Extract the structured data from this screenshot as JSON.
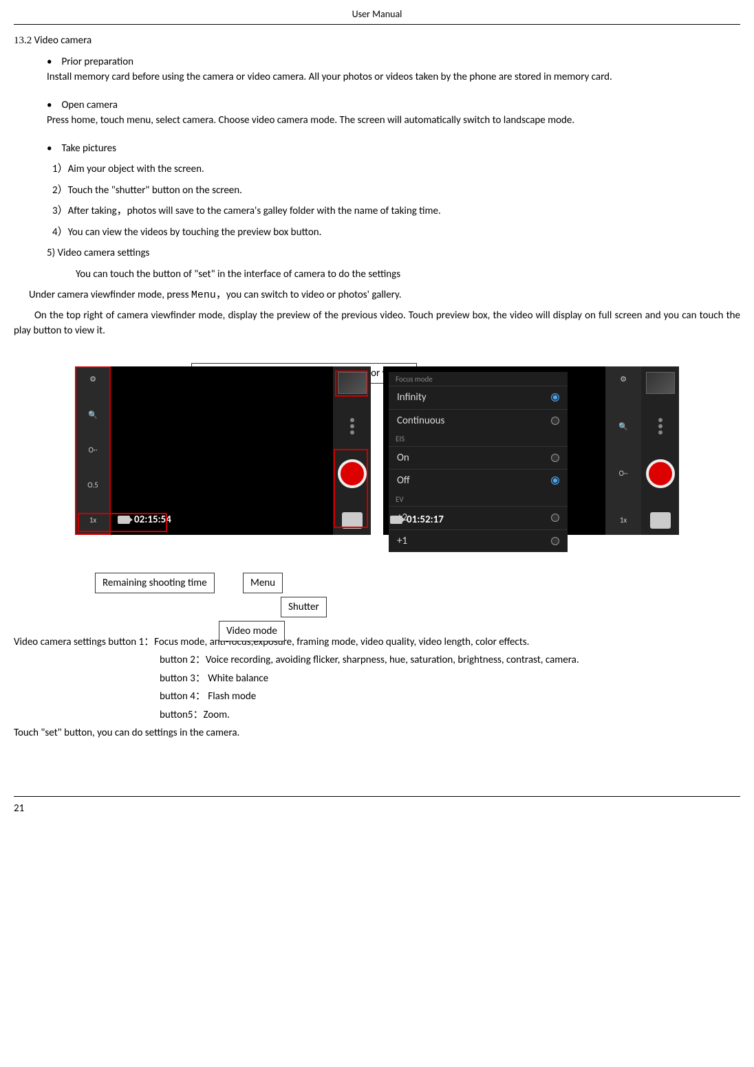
{
  "header": {
    "title": "User Manual"
  },
  "section": {
    "number": "13.2",
    "title": "Video camera"
  },
  "bullets": {
    "prior": {
      "label": "Prior preparation",
      "desc": "Install memory card before using the camera or video camera. All your photos or videos taken by the phone are stored in memory card."
    },
    "open": {
      "label": "Open camera",
      "desc": "Press home, touch menu, select camera. Choose video camera mode. The screen will automatically switch to landscape mode."
    },
    "take": {
      "label": "Take pictures",
      "steps": {
        "1": "1）Aim your object with the screen.",
        "2": "2）Touch the \"shutter\" button on the screen.",
        "3": "3）After taking，photos will save to the camera's galley folder with the name of taking time.",
        "4": "4）You can view the videos by touching the preview box button.",
        "5": "5) Video camera settings",
        "5desc": "You can touch the button of \"set\" in the interface of camera to do the settings"
      }
    }
  },
  "viewfinder": {
    "line1a": "Under camera viewfinder mode, press ",
    "line1_mono": "Menu",
    "line1b": "，you can switch to video or photos' gallery.",
    "line2": "On the top right of camera viewfinder mode, display the preview of the previous video. Touch preview box, the video will display on full screen and you can touch the play button to view it."
  },
  "figure": {
    "callouts": {
      "thumbnail": "Thumbnail display previous photographs or videos",
      "remaining": "Remaining shooting time",
      "menu": "Menu",
      "shutter": "Shutter",
      "video_mode": "Video mode"
    },
    "left_panel": {
      "time": "02:15:54",
      "toolbar": [
        "⚙",
        "🔍",
        "O··",
        "O.5",
        "1x"
      ]
    },
    "right_panel": {
      "time": "01:52:17",
      "menu": {
        "headers": [
          "Focus mode",
          "EIS",
          "EV"
        ],
        "items": [
          {
            "label": "Infinity",
            "selected": true
          },
          {
            "label": "Continuous",
            "selected": false
          },
          {
            "label": "On",
            "selected": false
          },
          {
            "label": "Off",
            "selected": true
          },
          {
            "label": "+2",
            "selected": false
          },
          {
            "label": "+1",
            "selected": false
          }
        ]
      },
      "toolbar": [
        "⚙",
        "🔍",
        "O··",
        "1x"
      ]
    }
  },
  "settings": {
    "b1": "Video camera settings button 1：Focus mode, anti-focus,exposure, framing mode, video quality, video length, color effects.",
    "b2": "button 2：Voice recording, avoiding flicker, sharpness, hue, saturation, brightness, contrast, camera.",
    "b3": "button 3： White balance",
    "b4": "button 4： Flash mode",
    "b5": "button5：Zoom.",
    "touch_set": "Touch \"set\" button, you can do settings in the camera."
  },
  "page": {
    "number": "21"
  }
}
